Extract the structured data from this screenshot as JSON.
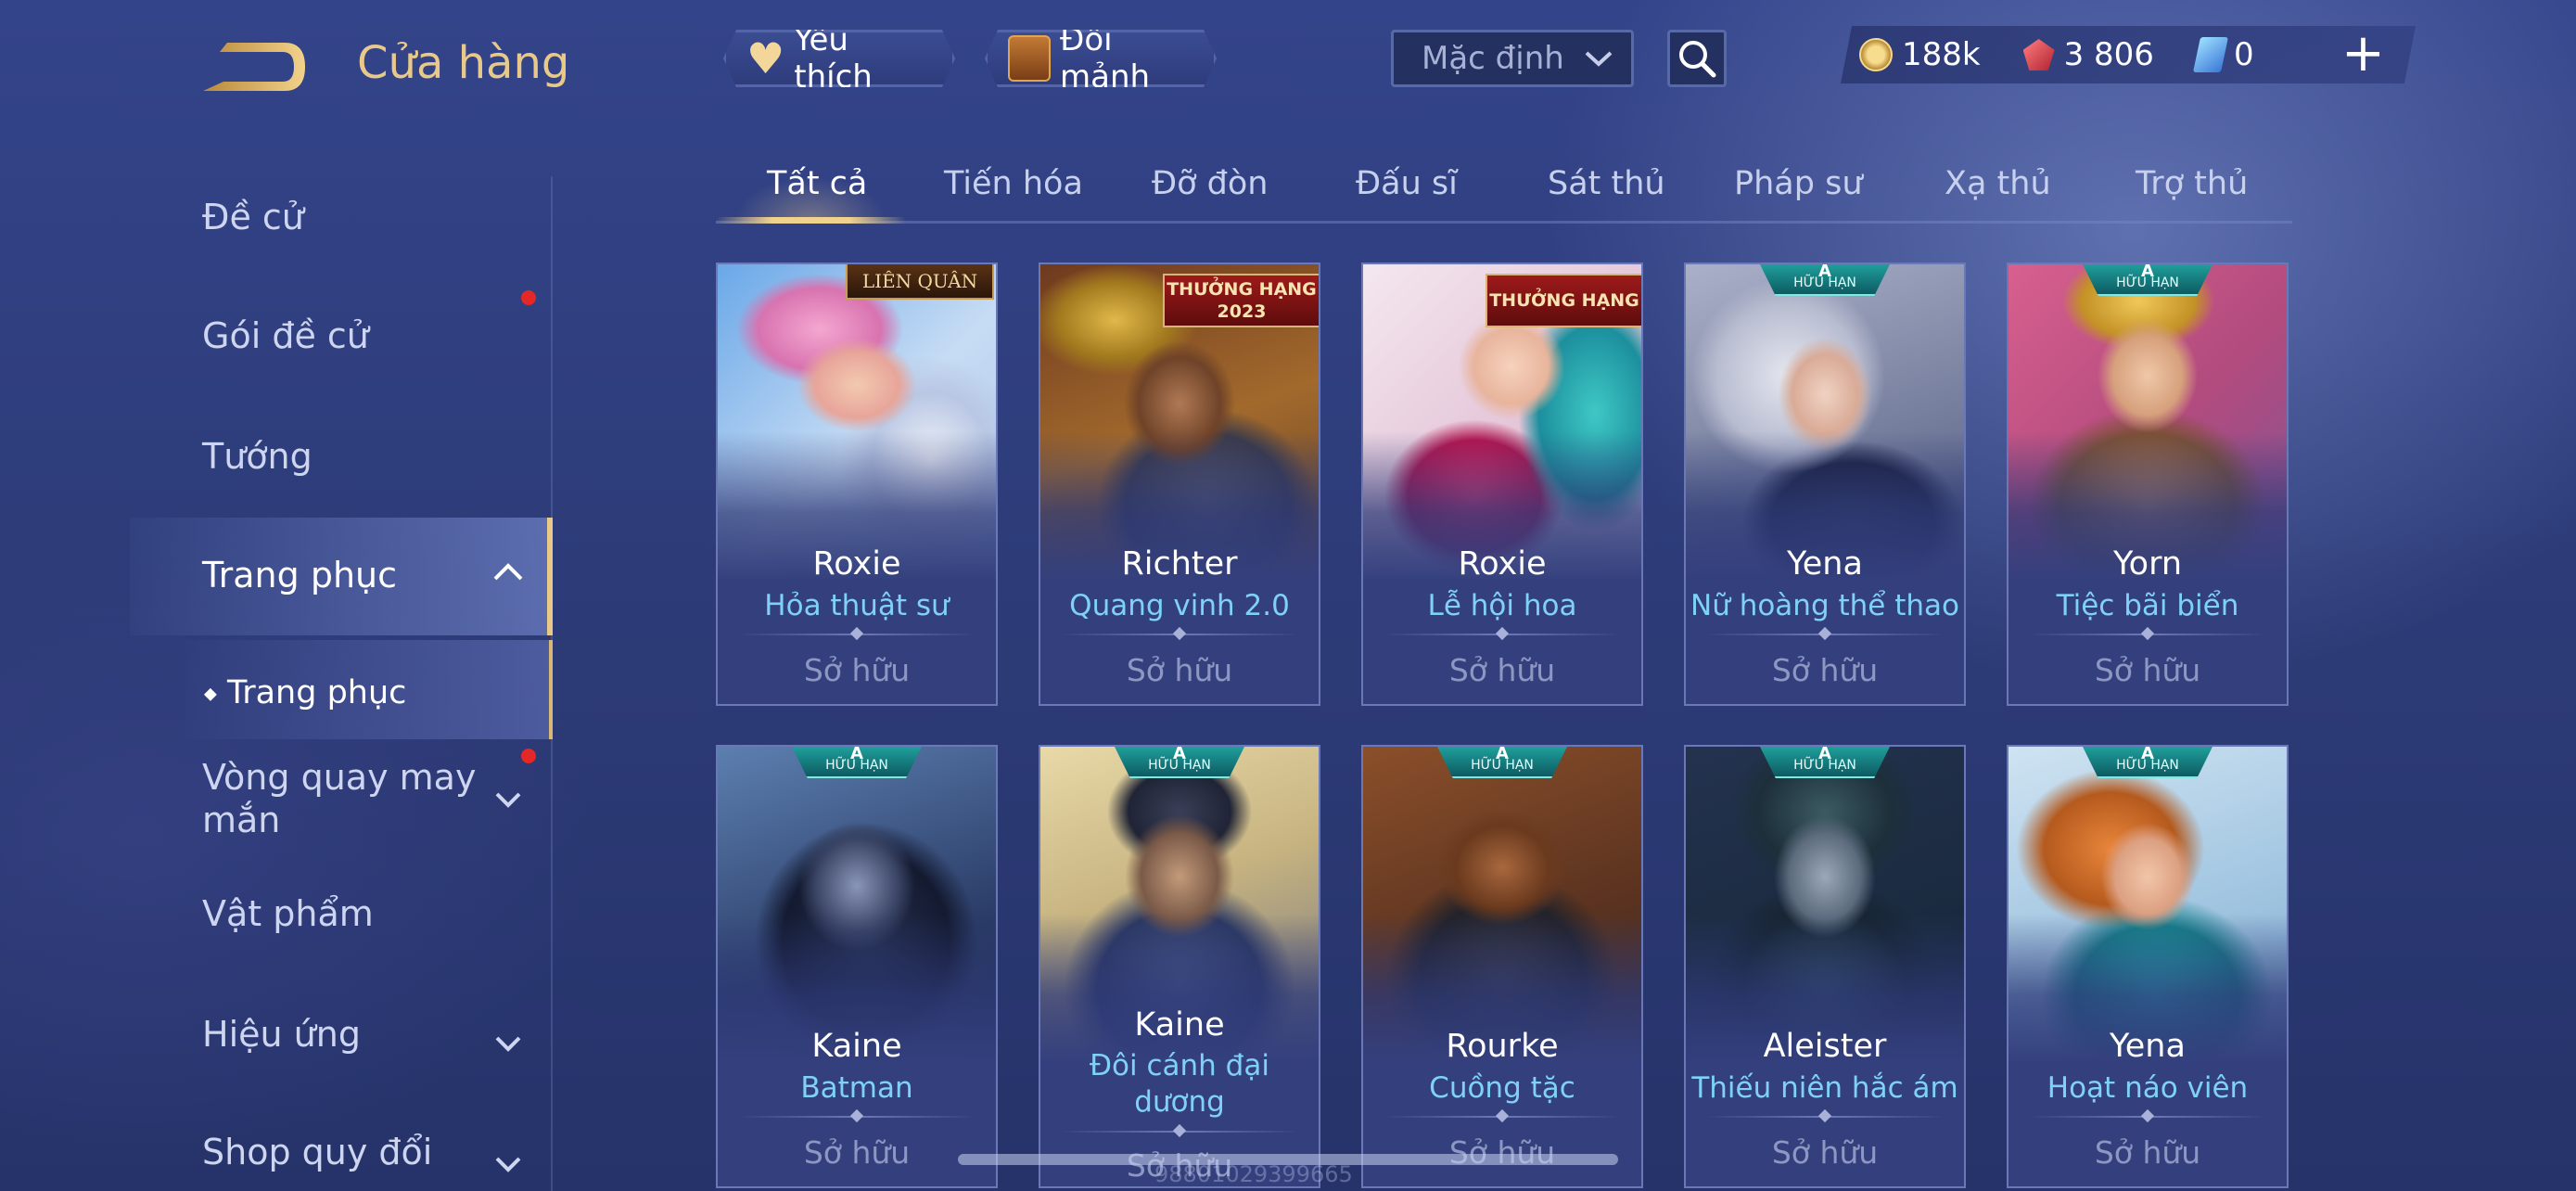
{
  "header": {
    "title": "Cửa hàng",
    "favorite_label": "Yêu thích",
    "exchange_label": "Đổi mảnh",
    "sort_value": "Mặc định"
  },
  "currency": {
    "gold": "188k",
    "ruby": "3 806",
    "voucher": "0"
  },
  "sidebar": {
    "items": [
      {
        "label": "Đề cử"
      },
      {
        "label": "Gói đề cử"
      },
      {
        "label": "Tướng"
      },
      {
        "label": "Trang phục"
      },
      {
        "label": "Vòng quay may mắn"
      },
      {
        "label": "Vật phẩm"
      },
      {
        "label": "Hiệu ứng"
      },
      {
        "label": "Shop quy đổi"
      }
    ],
    "sub_item": "Trang phục"
  },
  "tabs": [
    "Tất cả",
    "Tiến hóa",
    "Đỡ đòn",
    "Đấu sĩ",
    "Sát thủ",
    "Pháp sư",
    "Xạ thủ",
    "Trợ thủ"
  ],
  "cards": [
    {
      "hero": "Roxie",
      "skin": "Hỏa thuật sư",
      "status": "Sở hữu",
      "badge": "LIÊN QUÂN"
    },
    {
      "hero": "Richter",
      "skin": "Quang vinh 2.0",
      "status": "Sở hữu",
      "badge": "THƯỞNG HẠNG 2023"
    },
    {
      "hero": "Roxie",
      "skin": "Lễ hội hoa",
      "status": "Sở hữu",
      "badge": "THƯỞNG HẠNG"
    },
    {
      "hero": "Yena",
      "skin": "Nữ hoàng thể thao",
      "status": "Sở hữu",
      "badge": "HỮU HẠN"
    },
    {
      "hero": "Yorn",
      "skin": "Tiệc bãi biển",
      "status": "Sở hữu",
      "badge": "HỮU HẠN"
    },
    {
      "hero": "Kaine",
      "skin": "Batman",
      "status": "Sở hữu",
      "badge": "HỮU HẠN"
    },
    {
      "hero": "Kaine",
      "skin": "Đôi cánh đại dương",
      "status": "Sở hữu",
      "badge": "HỮU HẠN"
    },
    {
      "hero": "Rourke",
      "skin": "Cuồng tặc",
      "status": "Sở hữu",
      "badge": "HỮU HẠN"
    },
    {
      "hero": "Aleister",
      "skin": "Thiếu niên hắc ám",
      "status": "Sở hữu",
      "badge": "HỮU HẠN"
    },
    {
      "hero": "Yena",
      "skin": "Hoạt náo viên",
      "status": "Sở hữu",
      "badge": "HỮU HẠN"
    }
  ],
  "badge_grade": "A",
  "watermark": "98801029399665",
  "colors": {
    "accent_gold": "#e8c98a",
    "skin_name": "#7fd1f6",
    "background": "#2f3d7a"
  }
}
